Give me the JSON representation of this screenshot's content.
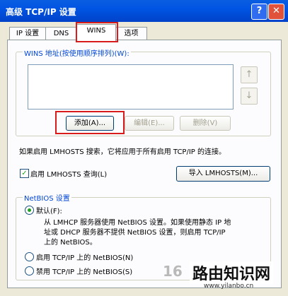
{
  "window": {
    "title": "高级 TCP/IP 设置",
    "help": "?",
    "close": "✕"
  },
  "tabs": [
    "IP 设置",
    "DNS",
    "WINS",
    "选项"
  ],
  "wins": {
    "group_label": "WINS 地址(按使用顺序排列)(W):",
    "up_arrow": "↑",
    "down_arrow": "↓",
    "add": "添加(A)...",
    "edit": "编辑(E)...",
    "delete": "删除(V)"
  },
  "lmhosts": {
    "info": "如果启用 LMHOSTS 搜索，它将应用于所有启用 TCP/IP 的连接。",
    "enable_label": "启用 LMHOSTS 查询(L)",
    "enable_checked": true,
    "import_button": "导入 LMHOSTS(M)..."
  },
  "netbios": {
    "group_label": "NetBIOS 设置",
    "default_label": "默认(F):",
    "default_desc": [
      "从 LMHCP 服务器使用 NetBIOS 设置。如果使用静态 IP 地",
      "址或 DHCP 服务器不提供 NetBIOS 设置，则启用 TCP/IP",
      "上的 NetBIOS。"
    ],
    "enable_label": "启用 TCP/IP 上的 NetBIOS(N)",
    "disable_label": "禁用 TCP/IP 上的 NetBIOS(S)",
    "selected": "default"
  },
  "watermark": {
    "faded": "16",
    "main": "路由知识网",
    "url": "www.yilanbo.cn"
  }
}
